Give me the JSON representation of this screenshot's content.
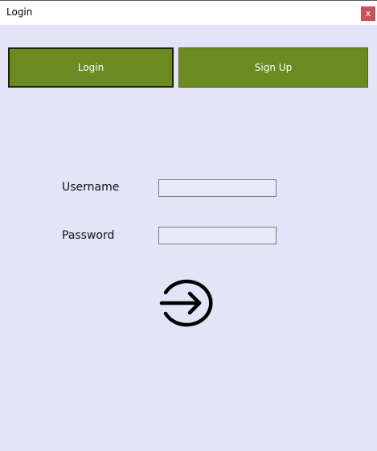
{
  "window": {
    "title": "Login",
    "close_label": "x"
  },
  "tabs": {
    "login_label": "Login",
    "signup_label": "Sign Up"
  },
  "form": {
    "username_label": "Username",
    "username_value": "",
    "password_label": "Password",
    "password_value": ""
  },
  "icons": {
    "submit": "login-arrow-icon"
  },
  "colors": {
    "background": "#e4e4f8",
    "tab_button": "#6b8a22",
    "close_button": "#c9525b"
  }
}
